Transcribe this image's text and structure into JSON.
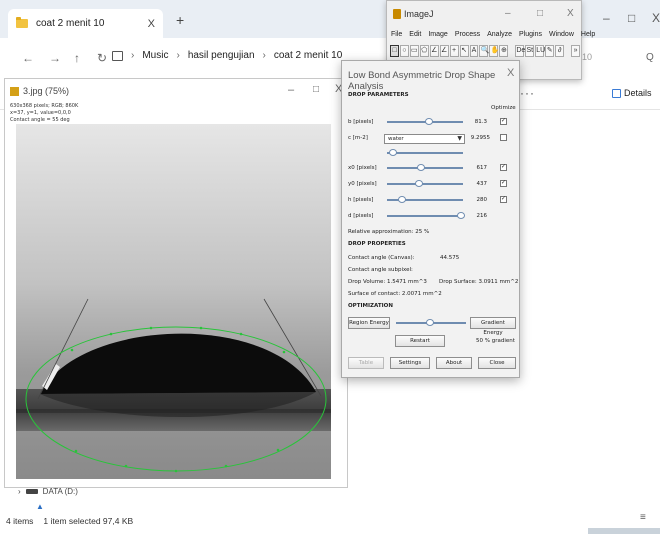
{
  "explorer": {
    "tab_title": "coat 2 menit 10",
    "tab_close": "X",
    "new_tab": "+",
    "window_buttons": [
      "–",
      "□",
      "X"
    ],
    "nav": {
      "back": "←",
      "forward": "→",
      "up": "↑",
      "refresh": "↻"
    },
    "breadcrumb": [
      "Music",
      "hasil pengujian",
      "coat 2 menit 10"
    ],
    "breadcrumb_sep": "›",
    "overflow_menu": "···",
    "details_label": "Details",
    "search_fragment": "10",
    "search_icon": "Q",
    "sidebar_item": "DATA (D:)",
    "status_items": "4 items",
    "status_selected": "1 item selected  97,4 KB",
    "view_icon": "≡",
    "folder_color": "#f2c340"
  },
  "image_window": {
    "title": "3.jpg (75%)",
    "info_line1": "630x368 pixels; RGB; 860K",
    "info_line2": "x=37, y=1, value=0,0,0",
    "info_line3": "Contact angle = 55 deg",
    "min": "–",
    "max": "□",
    "close": "X",
    "fit_color": "#29c43a",
    "tangent_color": "#444444"
  },
  "imagej": {
    "title": "ImageJ",
    "window_buttons": [
      "–",
      "□",
      "X"
    ],
    "menus": [
      "File",
      "Edit",
      "Image",
      "Process",
      "Analyze",
      "Plugins",
      "Window",
      "Help"
    ],
    "tools": [
      "□",
      "○",
      "▭",
      "⬠",
      "∠",
      "∠",
      "+",
      "↖",
      "A",
      "🔍",
      "✋",
      "⊕",
      "",
      "Dev",
      "St",
      "LUT",
      "✎",
      "∂",
      "",
      "»"
    ],
    "status_ghost": "10"
  },
  "dialog": {
    "title": "Low Bond Asymmetric Drop Shape Analysis",
    "close": "X",
    "section_params": "DROP PARAMETERS",
    "optimize_label": "Optimize",
    "params": [
      {
        "label": "b [pixels]",
        "value": "81.3",
        "checked": true,
        "knob": 0.55
      },
      {
        "label": "c [m-2]",
        "value": "9.2955",
        "checked": false,
        "knob": null
      },
      {
        "label": "x0 [pixels]",
        "value": "617",
        "checked": true,
        "knob": 0.45
      },
      {
        "label": "y0 [pixels]",
        "value": "437",
        "checked": true,
        "knob": 0.42
      },
      {
        "label": "h [pixels]",
        "value": "280",
        "checked": true,
        "knob": 0.2
      },
      {
        "label": "d [pixels]",
        "value": "216",
        "checked": false,
        "knob": 0.98
      }
    ],
    "liquid_select": "water",
    "c_knob": 0.08,
    "relative_approx": "Relative approximation: 25 %",
    "section_props": "DROP PROPERTIES",
    "contact_angle_label": "Contact angle (Canvas):",
    "contact_angle_value": "44.575",
    "contact_angle_sub": "Contact angle subpixel:",
    "drop_volume": "Drop Volume: 1.5471 mm^3",
    "drop_surface": "Drop Surface: 3.0911 mm^2",
    "surface_contact": "Surface of contact: 2.0071 mm^2",
    "section_opt": "OPTIMIZATION",
    "region_energy": "Region Energy",
    "gradient_energy": "Gradient Energy",
    "opt_knob": 0.48,
    "gradient_pct": "50 % gradient",
    "restart": "Restart",
    "table": "Table",
    "settings": "Settings",
    "about": "About",
    "close_btn": "Close",
    "accent_color": "#6f8cb0"
  }
}
